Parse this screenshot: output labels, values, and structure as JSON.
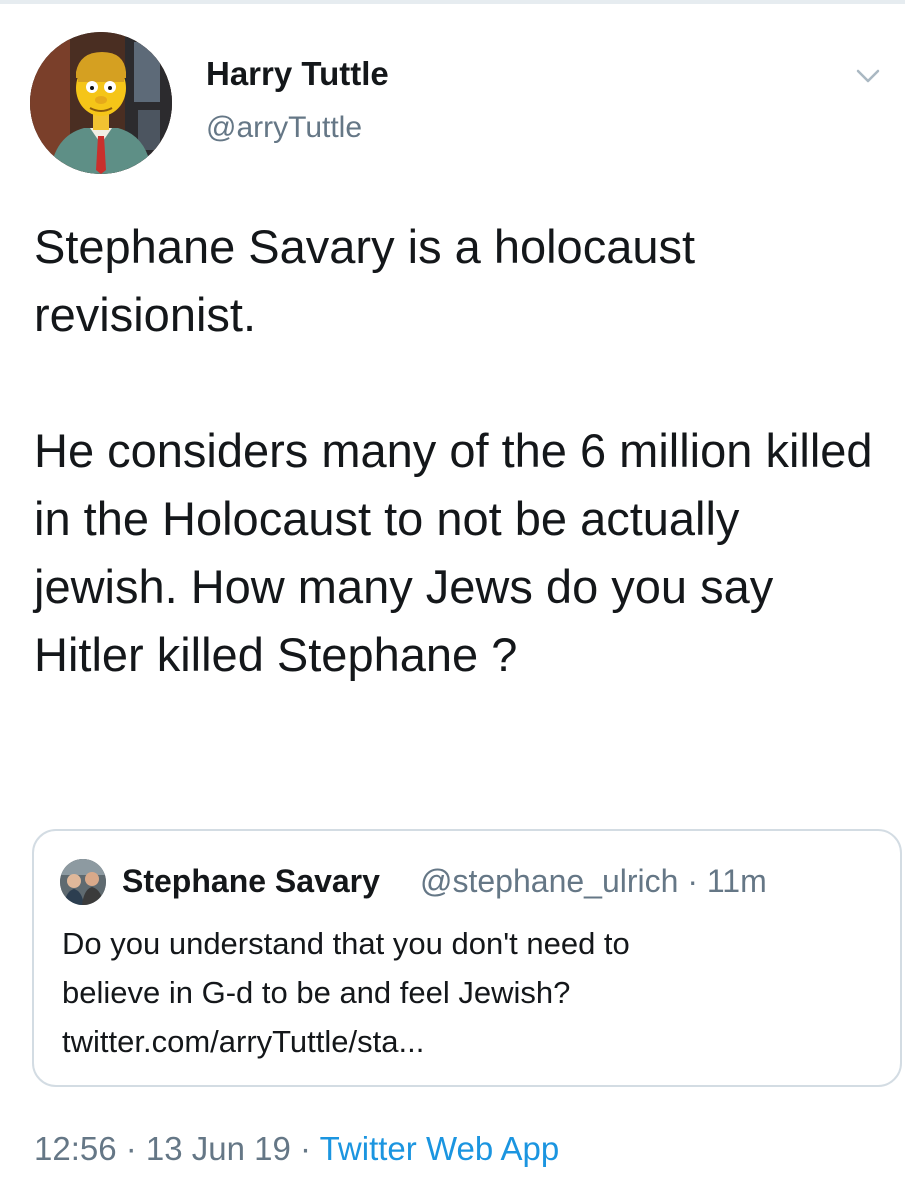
{
  "author": {
    "display_name": "Harry Tuttle",
    "handle": "@arryTuttle"
  },
  "tweet": {
    "paragraphs": [
      "Stephane Savary is a holocaust revisionist.",
      "He considers many of the 6 million killed in the Holocaust to not be actually jewish. How many Jews do you say Hitler killed Stephane ?"
    ]
  },
  "quoted_tweet": {
    "display_name": "Stephane Savary",
    "meta": "@stephane_ulrich · 11m",
    "lines": [
      "Do you understand that you don't need to",
      "believe in G-d to be and feel Jewish?",
      "twitter.com/arryTuttle/sta..."
    ]
  },
  "footer": {
    "timestamp": "12:56 · 13 Jun 19 · ",
    "source": "Twitter Web App"
  },
  "icons": {
    "caret": "chevron-down-icon",
    "avatar": "avatar",
    "quote_avatar": "avatar"
  },
  "colors": {
    "text": "#14171a",
    "secondary": "#657786",
    "link": "#1b95e0",
    "border": "#d3dce3"
  }
}
